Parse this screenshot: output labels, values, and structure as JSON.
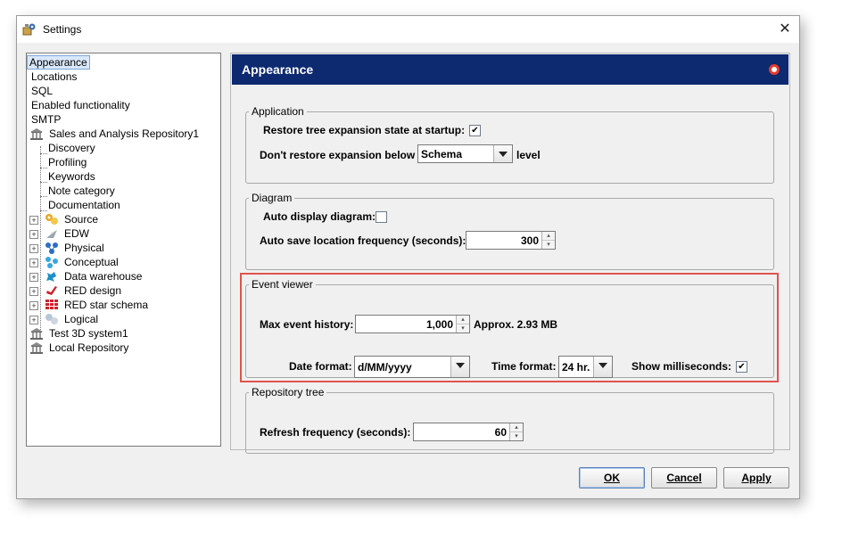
{
  "window": {
    "title": "Settings",
    "close_glyph": "✕"
  },
  "tree": {
    "items": [
      "Appearance",
      "Locations",
      "SQL",
      "Enabled functionality",
      "SMTP",
      "Sales and Analysis Repository1",
      "Discovery",
      "Profiling",
      "Keywords",
      "Note category",
      "Documentation",
      "Source",
      "EDW",
      "Physical",
      "Conceptual",
      "Data warehouse",
      "RED design",
      "RED star schema",
      "Logical",
      "Test 3D system1",
      "Local Repository"
    ],
    "expander_glyph": "+"
  },
  "panel": {
    "title": "Appearance",
    "application": {
      "legend": "Application",
      "restore_label": "Restore tree expansion state at startup:",
      "restore_checked": "✔",
      "dont_restore_label": "Don't restore expansion below",
      "level_value": "Schema",
      "level_suffix": "level"
    },
    "diagram": {
      "legend": "Diagram",
      "auto_display_label": "Auto display diagram:",
      "auto_save_label": "Auto save location frequency (seconds):",
      "auto_save_value": "300"
    },
    "event_viewer": {
      "legend": "Event viewer",
      "max_history_label": "Max event history:",
      "max_history_value": "1,000",
      "approx": "Approx. 2.93 MB",
      "date_format_label": "Date format:",
      "date_format_value": "d/MM/yyyy",
      "time_format_label": "Time format:",
      "time_format_value": "24 hr.",
      "show_ms_label": "Show milliseconds:",
      "show_ms_checked": "✔"
    },
    "repository_tree": {
      "legend": "Repository tree",
      "refresh_label": "Refresh frequency (seconds):",
      "refresh_value": "60"
    }
  },
  "buttons": {
    "ok": "OK",
    "cancel": "Cancel",
    "apply": "Apply"
  },
  "colors": {
    "header": "#0d2970",
    "highlight": "#e1534d"
  }
}
